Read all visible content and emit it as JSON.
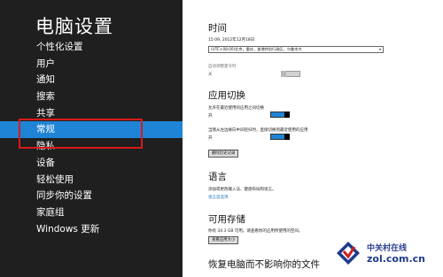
{
  "nav": {
    "title": "电脑设置",
    "items": [
      {
        "label": "个性化设置"
      },
      {
        "label": "用户"
      },
      {
        "label": "通知"
      },
      {
        "label": "搜索"
      },
      {
        "label": "共享"
      },
      {
        "label": "常规",
        "selected": true
      },
      {
        "label": "隐私"
      },
      {
        "label": "设备"
      },
      {
        "label": "轻松使用"
      },
      {
        "label": "同步你的设置"
      },
      {
        "label": "家庭组"
      },
      {
        "label": "Windows 更新"
      }
    ]
  },
  "content": {
    "time": {
      "title": "时间",
      "datetime": "15:09, 2012年12月18日",
      "timezone": "(UTC+08:00)北京，重庆，香港特别行政区，乌鲁木齐",
      "dst_label": "自动调整夏令时",
      "dst_state": "关",
      "dst_on": false
    },
    "app_switch": {
      "title": "应用切换",
      "option1_label": "允许在最近使用的应用之间切换",
      "option1_state": "开",
      "option1_on": true,
      "option2_label": "当我从左边缘向中间轻扫时，直接切换到最近使用的应用",
      "option2_state": "开",
      "option2_on": true,
      "clear_history_button": "删除历史记录"
    },
    "language": {
      "title": "语言",
      "description": "添加或更改输入法、键盘布局和语言。",
      "link": "语言首选项"
    },
    "storage": {
      "title": "可用存储",
      "description": "你有 34.3 GB 可用。请查看你的应用所使用的空间。",
      "button": "查看应用大小"
    },
    "recovery": {
      "title": "恢复电脑而不影响你的文件"
    }
  },
  "watermark": {
    "line1": "中关村在线",
    "line2": "zol.com.cn",
    "colors": {
      "primary": "#1e3a8a",
      "accent": "#c82020"
    }
  },
  "colors": {
    "nav_bg": "#1f1f1f",
    "accent": "#1f84d6",
    "highlight_box": "#d91a1a"
  }
}
